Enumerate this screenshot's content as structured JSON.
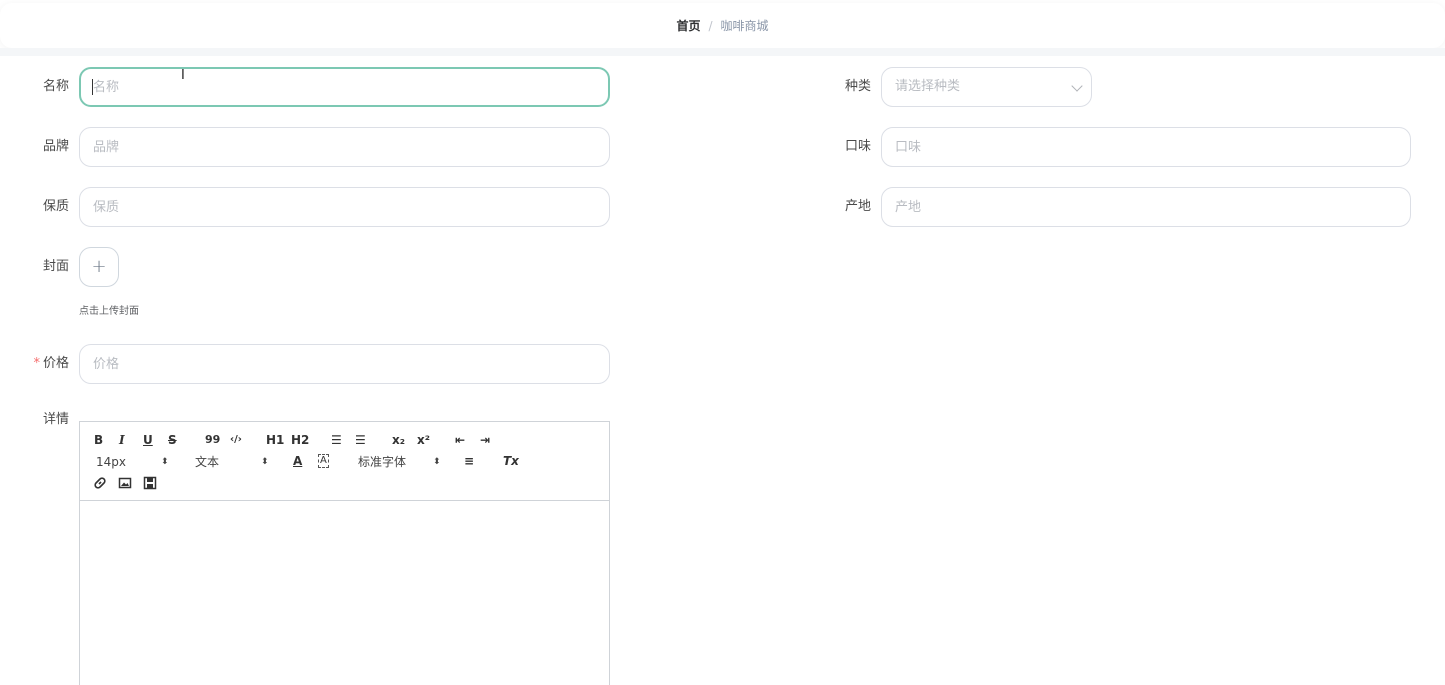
{
  "breadcrumb": {
    "home": "首页",
    "separator": "/",
    "current": "咖啡商城"
  },
  "form": {
    "name": {
      "label": "名称",
      "placeholder": "名称"
    },
    "category": {
      "label": "种类",
      "placeholder": "请选择种类"
    },
    "brand": {
      "label": "品牌",
      "placeholder": "品牌"
    },
    "taste": {
      "label": "口味",
      "placeholder": "口味"
    },
    "shelf_life": {
      "label": "保质",
      "placeholder": "保质"
    },
    "origin": {
      "label": "产地",
      "placeholder": "产地"
    },
    "cover": {
      "label": "封面",
      "plus": "+",
      "hint": "点击上传封面"
    },
    "price": {
      "label": "价格",
      "required_mark": "*",
      "placeholder": "价格"
    },
    "details": {
      "label": "详情"
    }
  },
  "editor_toolbar": {
    "bold": "B",
    "italic": "I",
    "underline": "U",
    "strike": "S",
    "quote": "99",
    "code": "‹/›",
    "h1": "H1",
    "h2": "H2",
    "ordered_list": "☰",
    "bullet_list": "☰",
    "subscript": "x₂",
    "superscript": "x²",
    "outdent": "⇤",
    "indent": "⇥",
    "size": "14px",
    "header": "文本",
    "text_color": "A",
    "bg_color": "A",
    "font": "标准字体",
    "align": "≡",
    "clean": "Tx",
    "link_icon": "link-icon",
    "image_icon": "image-icon",
    "video_icon": "video-icon"
  },
  "colors": {
    "focus_border": "#7cc8b3",
    "required": "#f56c6c"
  }
}
